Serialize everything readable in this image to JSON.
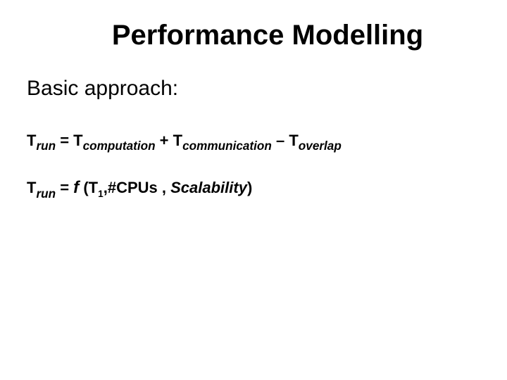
{
  "slide": {
    "title": "Performance Modelling",
    "subtitle": "Basic approach:",
    "eq1": {
      "T": "T",
      "run": "run",
      "eq": " = ",
      "T2": "T",
      "computation": "computation",
      "plus": " + ",
      "T3": "T",
      "communication": "communication",
      "minus": " – ",
      "T4": "T",
      "overlap": "overlap"
    },
    "eq2": {
      "T": "T",
      "run": "run",
      "eq": " = ",
      "f": "f",
      "open": " (T",
      "one": "1",
      "comma": ",",
      "cpus": "#CPUs , ",
      "scalability": "Scalability",
      "close": ")"
    }
  }
}
